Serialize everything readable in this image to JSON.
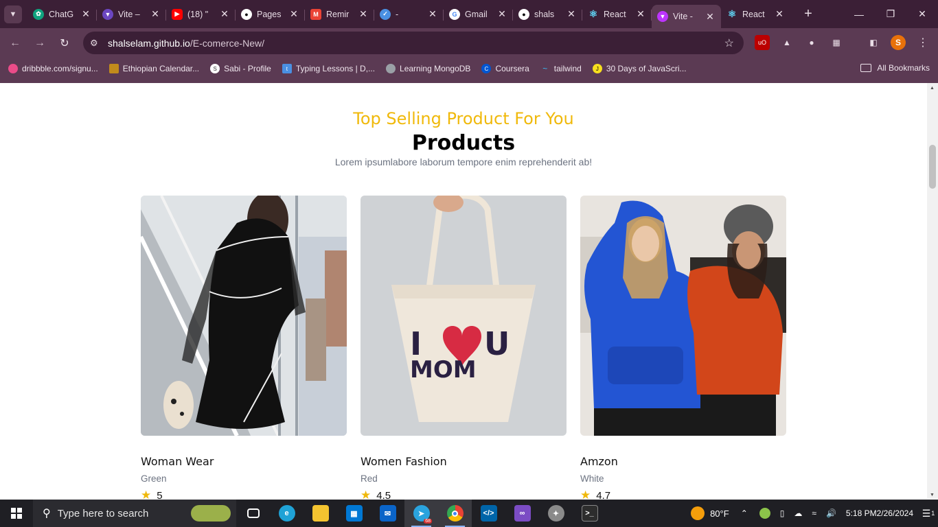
{
  "browser": {
    "tabs": [
      {
        "title": "ChatG",
        "icon": "chatgpt-icon",
        "color": "#10a37f"
      },
      {
        "title": "Vite –",
        "icon": "vite-icon",
        "color": "#646cff"
      },
      {
        "title": "(18) \"",
        "icon": "youtube-icon",
        "color": "#ff0000"
      },
      {
        "title": "Pages",
        "icon": "github-icon",
        "color": "#ffffff"
      },
      {
        "title": "Remir",
        "icon": "gmail-icon",
        "color": "#ea4335"
      },
      {
        "title": "-",
        "icon": "check-icon",
        "color": "#4a90e2"
      },
      {
        "title": "Gmail",
        "icon": "google-icon",
        "color": "#4285f4"
      },
      {
        "title": "shals",
        "icon": "github-icon",
        "color": "#ffffff"
      },
      {
        "title": "React",
        "icon": "react-icon",
        "color": "#61dafb"
      },
      {
        "title": "Vite -",
        "icon": "vite-icon",
        "color": "#bd34fe",
        "active": true
      },
      {
        "title": "React",
        "icon": "react-icon",
        "color": "#61dafb"
      }
    ],
    "url_host": "shalselam.github.io",
    "url_path": "/E-comerce-New/",
    "profile_initial": "S",
    "bookmarks": [
      {
        "label": "dribbble.com/signu...",
        "color": "#ea4c89"
      },
      {
        "label": "Ethiopian Calendar...",
        "color": "#c28b1c"
      },
      {
        "label": "Sabi - Profile",
        "color": "#ffffff"
      },
      {
        "label": "Typing Lessons | D,...",
        "color": "#4a90e2"
      },
      {
        "label": "Learning MongoDB",
        "color": "#9aa0a6"
      },
      {
        "label": "Coursera",
        "color": "#0056d2"
      },
      {
        "label": "tailwind",
        "color": "#38bdf8"
      },
      {
        "label": "30 Days of JavaScri...",
        "color": "#f7df1e"
      }
    ],
    "all_bookmarks": "All Bookmarks"
  },
  "page": {
    "subtitle": "Top Selling Product For You",
    "title": "Products",
    "description": "Lorem ipsumlabore laborum tempore enim reprehenderit ab!",
    "accent": "#f0b90b"
  },
  "products": [
    {
      "name": "Woman Wear",
      "color": "Green",
      "rating": "5"
    },
    {
      "name": "Women Fashion",
      "color": "Red",
      "rating": "4.5"
    },
    {
      "name": "Amzon",
      "color": "White",
      "rating": "4.7"
    }
  ],
  "bag_text": {
    "line1a": "I",
    "line1b": "U",
    "line2": "MOM"
  },
  "taskbar": {
    "search_placeholder": "Type here to search",
    "telegram_badge": "68",
    "weather": "80°F",
    "time": "5:18 PM",
    "date": "2/26/2024",
    "notifications": "1"
  }
}
